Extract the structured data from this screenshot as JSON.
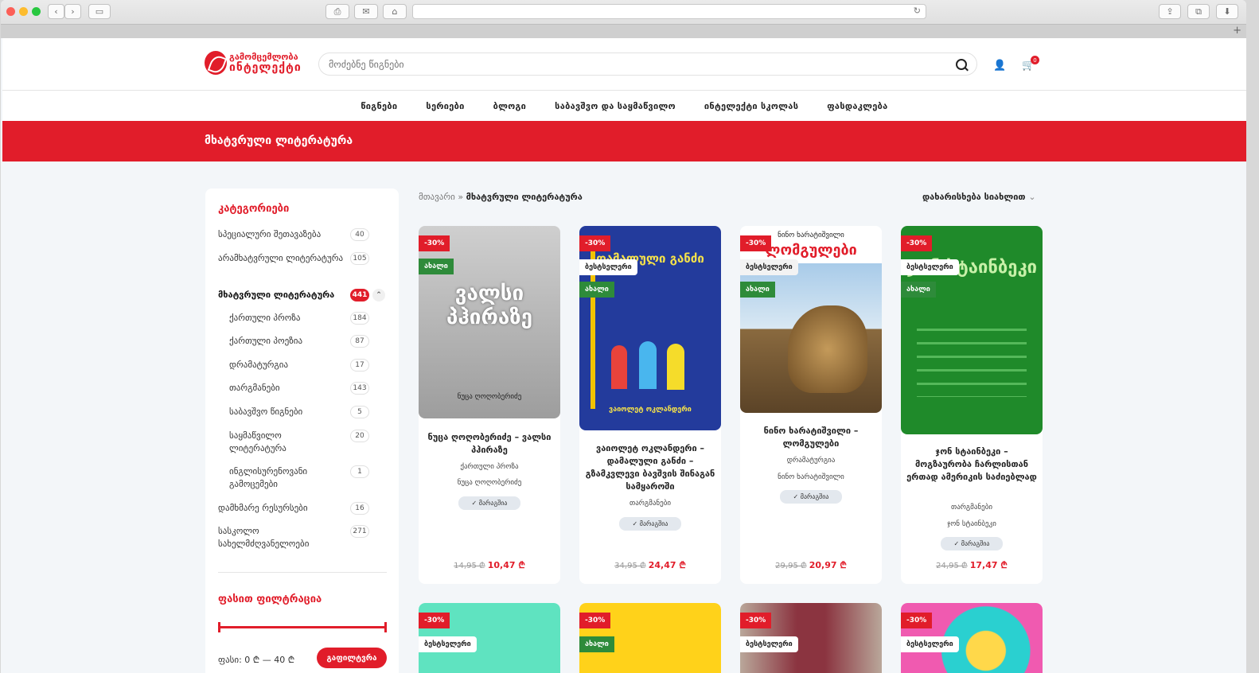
{
  "browser": {
    "address": ""
  },
  "header": {
    "logo_line1": "გამომცემლობა",
    "logo_line2": "ინტელექტი",
    "search_placeholder": "მოძებნე წიგნები",
    "cart_count": "0"
  },
  "nav": [
    "წიგნები",
    "სერიები",
    "ბლოგი",
    "საბავშვო და საყმაწვილო",
    "ინტელექტი სკოლას",
    "ფასდაკლება"
  ],
  "banner": {
    "title": "მხატვრული ლიტერატურა"
  },
  "sidebar": {
    "categories_title": "კატეგორიები",
    "categories": [
      {
        "label": "სპეციალური შეთავაზება",
        "count": "40"
      },
      {
        "label": "არამხატვრული ლიტერატურა",
        "count": "105"
      },
      {
        "label": "მხატვრული ლიტერატურა",
        "count": "441"
      },
      {
        "label": "ქართული პროზა",
        "count": "184"
      },
      {
        "label": "ქართული პოეზია",
        "count": "87"
      },
      {
        "label": "დრამატურგია",
        "count": "17"
      },
      {
        "label": "თარგმანები",
        "count": "143"
      },
      {
        "label": "საბავშვო წიგნები",
        "count": "5"
      },
      {
        "label": "საყმაწვილო ლიტერატურა",
        "count": "20"
      },
      {
        "label": "ინგლისურენოვანი გამოცემები",
        "count": "1"
      },
      {
        "label": "დამხმარე რესურსები",
        "count": "16"
      },
      {
        "label": "სასკოლო სახელმძღვანელოები",
        "count": "271"
      }
    ],
    "price_title": "ფასით ფილტრაცია",
    "price_label": "ფასი: 0 ₾ — 40 ₾",
    "filter_button": "გაფილტვრა"
  },
  "breadcrumb": {
    "home": "მთავარი",
    "sep": "»",
    "current": "მხატვრული ლიტერატურა"
  },
  "sort": {
    "label": "დახარისხება სიახლით"
  },
  "labels": {
    "sale": "-30%",
    "new": "ახალი",
    "best": "ბესტსელერი",
    "stock": "მარაგშია"
  },
  "products": [
    {
      "title": "ნუცა ღოღობერიძე – ვალსი პჰირაზე",
      "category": "ქართული პროზა",
      "author": "ნუცა ღოღობერიძე",
      "old_price": "14,95 ₾",
      "price": "10,47 ₾",
      "cover_title": "ვალსი პჰირაზე",
      "cover_author": "ნუცა ღოღობერიძე",
      "cover_color": "#b9b9b9"
    },
    {
      "title": "ვაიოლეტ ოკლანდერი – დამალული განძი – გზამკვლევი ბავშვის შინაგან სამყაროში",
      "category": "თარგმანები",
      "author": "",
      "old_price": "34,95 ₾",
      "price": "24,47 ₾",
      "cover_title": "დამალული განძი",
      "cover_author": "ვაიოლეტ ოკლანდერი",
      "cover_color": "#233b9c"
    },
    {
      "title": "ნინო ხარატიშვილი – ლომგულები",
      "category": "დრამატურგია",
      "author": "ნინო ხარატიშვილი",
      "old_price": "29,95 ₾",
      "price": "20,97 ₾",
      "cover_title": "ლომგულები",
      "cover_author": "ნინო ხარატიშვილი",
      "cover_color": "#ffffff"
    },
    {
      "title": "ჯონ სტაინბეკი – მოგზაურობა ჩარლისთან ერთად ამერიკის საძიებლად",
      "category": "თარგმანები",
      "author": "ჯონ სტაინბეკი",
      "old_price": "24,95 ₾",
      "price": "17,47 ₾",
      "cover_title": "ჯონ სტაინბეკი",
      "cover_author": "",
      "cover_color": "#1f8a2a"
    }
  ]
}
